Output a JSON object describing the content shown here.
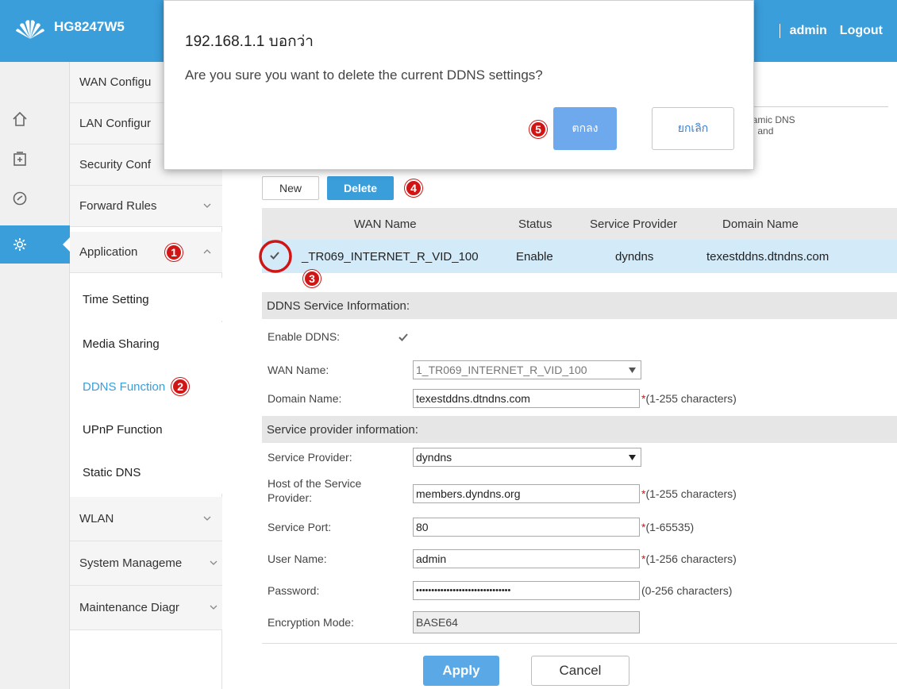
{
  "header": {
    "model": "HG8247W5",
    "user": "admin",
    "logout": "Logout"
  },
  "rail": {
    "items": [
      "home-icon",
      "add-box-icon",
      "gauge-icon",
      "gear-icon"
    ],
    "active": 3
  },
  "menu": {
    "items": [
      {
        "label": "WAN Configu"
      },
      {
        "label": "LAN Configur"
      },
      {
        "label": "Security Conf"
      },
      {
        "label": "Forward Rules"
      },
      {
        "label": "Application"
      },
      {
        "label": "WLAN"
      },
      {
        "label": "System Manageme"
      },
      {
        "label": "Maintenance Diagr"
      }
    ],
    "sub_items": [
      "Time Setting",
      "Media Sharing",
      "DDNS Function",
      "UPnP Function",
      "Static DNS"
    ],
    "active_sub": "DDNS Function"
  },
  "annotations": {
    "b1": "1",
    "b2": "2",
    "b3": "3",
    "b4": "4",
    "b5": "5"
  },
  "content": {
    "desc_line1": "namic DNS",
    "desc_line2": "e, and",
    "buttons": {
      "new": "New",
      "delete": "Delete"
    },
    "table": {
      "headers": [
        "WAN Name",
        "Status",
        "Service Provider",
        "Domain Name"
      ],
      "row": {
        "wan_name": "_TR069_INTERNET_R_VID_100",
        "status": "Enable",
        "provider": "dyndns",
        "domain": "texestddns.dtndns.com"
      }
    },
    "ddns_section": {
      "title": "DDNS Service Information:",
      "enable_label": "Enable DDNS:",
      "wan_label": "WAN Name:",
      "wan_value": "1_TR069_INTERNET_R_VID_100",
      "domain_label": "Domain Name:",
      "domain_value": "texestddns.dtndns.com",
      "domain_hint": "(1-255 characters)"
    },
    "provider_section": {
      "title": "Service provider information:",
      "provider_label": "Service Provider:",
      "provider_value": "dyndns",
      "host_label_1": "Host of the Service",
      "host_label_2": "Provider:",
      "host_value": "members.dyndns.org",
      "host_hint": "(1-255 characters)",
      "port_label": "Service Port:",
      "port_value": "80",
      "port_hint": "(1-65535)",
      "user_label": "User Name:",
      "user_value": "admin",
      "user_hint": "(1-256 characters)",
      "password_label": "Password:",
      "password_value": "•••••••••••••••••••••••••••••••",
      "password_hint": "(0-256 characters)",
      "enc_label": "Encryption Mode:",
      "enc_value": "BASE64"
    },
    "apply": "Apply",
    "cancel": "Cancel"
  },
  "dialog": {
    "title": "192.168.1.1 บอกว่า",
    "message": "Are you sure you want to delete the current DDNS settings?",
    "ok": "ตกลง",
    "cancel": "ยกเลิก"
  },
  "colors": {
    "accent": "#3a9edb",
    "badge": "#d01515",
    "selected_row": "#d3eaf9"
  }
}
